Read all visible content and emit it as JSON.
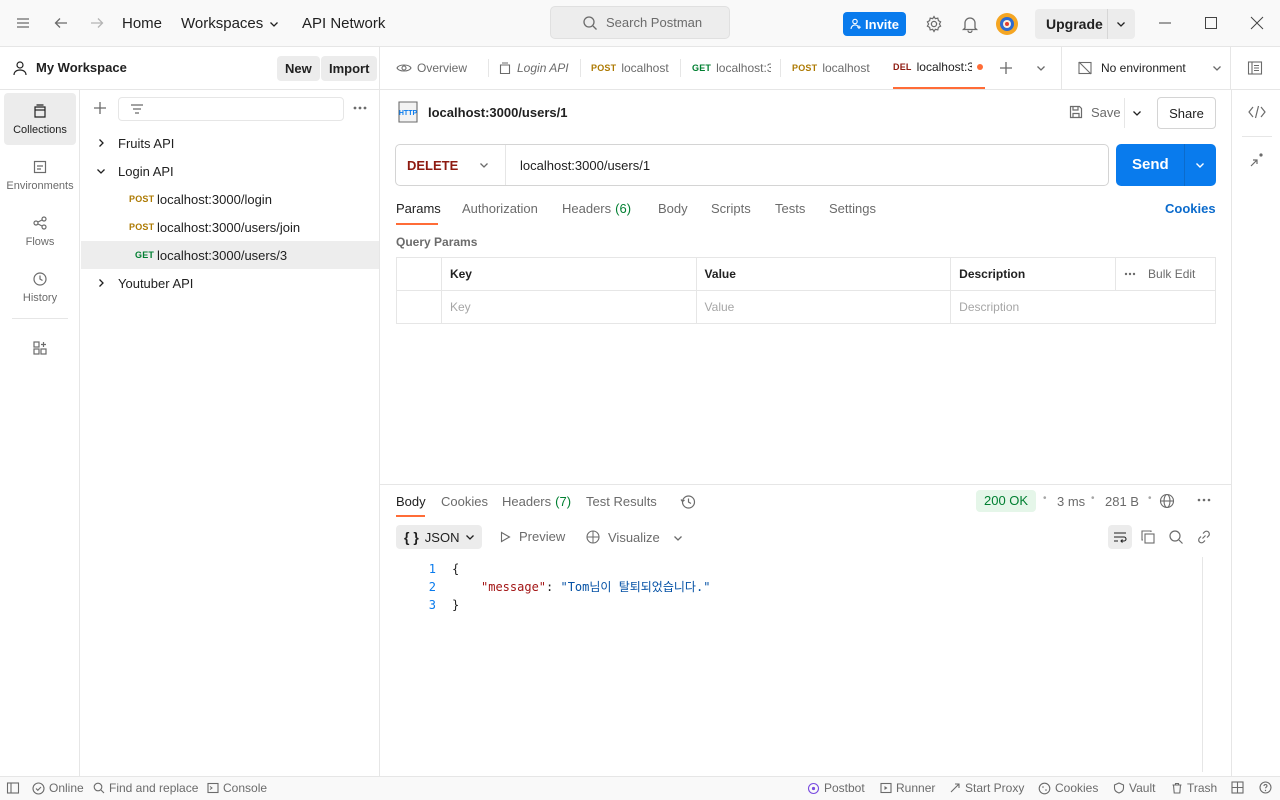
{
  "topbar": {
    "home": "Home",
    "workspaces": "Workspaces",
    "api_network": "API Network",
    "search_placeholder": "Search Postman",
    "invite": "Invite",
    "upgrade": "Upgrade"
  },
  "workspace": {
    "name": "My Workspace",
    "new_label": "New",
    "import_label": "Import"
  },
  "rail": [
    {
      "label": "Collections",
      "icon": "collections-icon"
    },
    {
      "label": "Environments",
      "icon": "environments-icon"
    },
    {
      "label": "Flows",
      "icon": "flows-icon"
    },
    {
      "label": "History",
      "icon": "history-icon"
    }
  ],
  "tree": {
    "fruits": "Fruits API",
    "login": "Login API",
    "req1_method": "POST",
    "req1_url": "localhost:3000/login",
    "req2_method": "POST",
    "req2_url": "localhost:3000/users/join",
    "req3_method": "GET",
    "req3_url": "localhost:3000/users/3",
    "youtuber": "Youtuber API"
  },
  "tabs": {
    "overview": "Overview",
    "login_api": "Login API",
    "t1_method": "POST",
    "t1_label": "localhost",
    "t2_method": "GET",
    "t2_label": "localhost:3",
    "t3_method": "POST",
    "t3_label": "localhost",
    "t4_method": "DEL",
    "t4_label": "localhost:3",
    "environment": "No environment"
  },
  "request": {
    "title": "localhost:3000/users/1",
    "save": "Save",
    "share": "Share",
    "method": "DELETE",
    "url": "localhost:3000/users/1",
    "send": "Send",
    "subtabs": {
      "params": "Params",
      "authorization": "Authorization",
      "headers": "Headers",
      "headers_count": "(6)",
      "body": "Body",
      "scripts": "Scripts",
      "tests": "Tests",
      "settings": "Settings",
      "cookies": "Cookies"
    },
    "query_params_title": "Query Params",
    "params_table": {
      "headers": [
        "Key",
        "Value",
        "Description"
      ],
      "bulk_edit": "Bulk Edit",
      "placeholders": [
        "Key",
        "Value",
        "Description"
      ]
    }
  },
  "response": {
    "tabs": {
      "body": "Body",
      "cookies": "Cookies",
      "headers": "Headers",
      "headers_count": "(7)",
      "test_results": "Test Results"
    },
    "status": "200 OK",
    "time": "3 ms",
    "size": "281 B",
    "format": "JSON",
    "preview": "Preview",
    "visualize": "Visualize",
    "lines": [
      "1",
      "2",
      "3"
    ],
    "code_open": "{",
    "code_key": "\"message\"",
    "code_colon": ": ",
    "code_value": "\"Tom님이 탈퇴되었습니다.\"",
    "code_close": "}"
  },
  "statusbar": {
    "online": "Online",
    "find_replace": "Find and replace",
    "console": "Console",
    "postbot": "Postbot",
    "runner": "Runner",
    "start_proxy": "Start Proxy",
    "cookies": "Cookies",
    "vault": "Vault",
    "trash": "Trash"
  },
  "colors": {
    "accent_blue": "#097bed",
    "tab_active": "#ff6c37",
    "delete_method": "#8e1a10",
    "post_method": "#ad7a03",
    "get_method": "#007f31",
    "status_ok_bg": "#e5f6e9",
    "status_ok_text": "#007f31"
  }
}
